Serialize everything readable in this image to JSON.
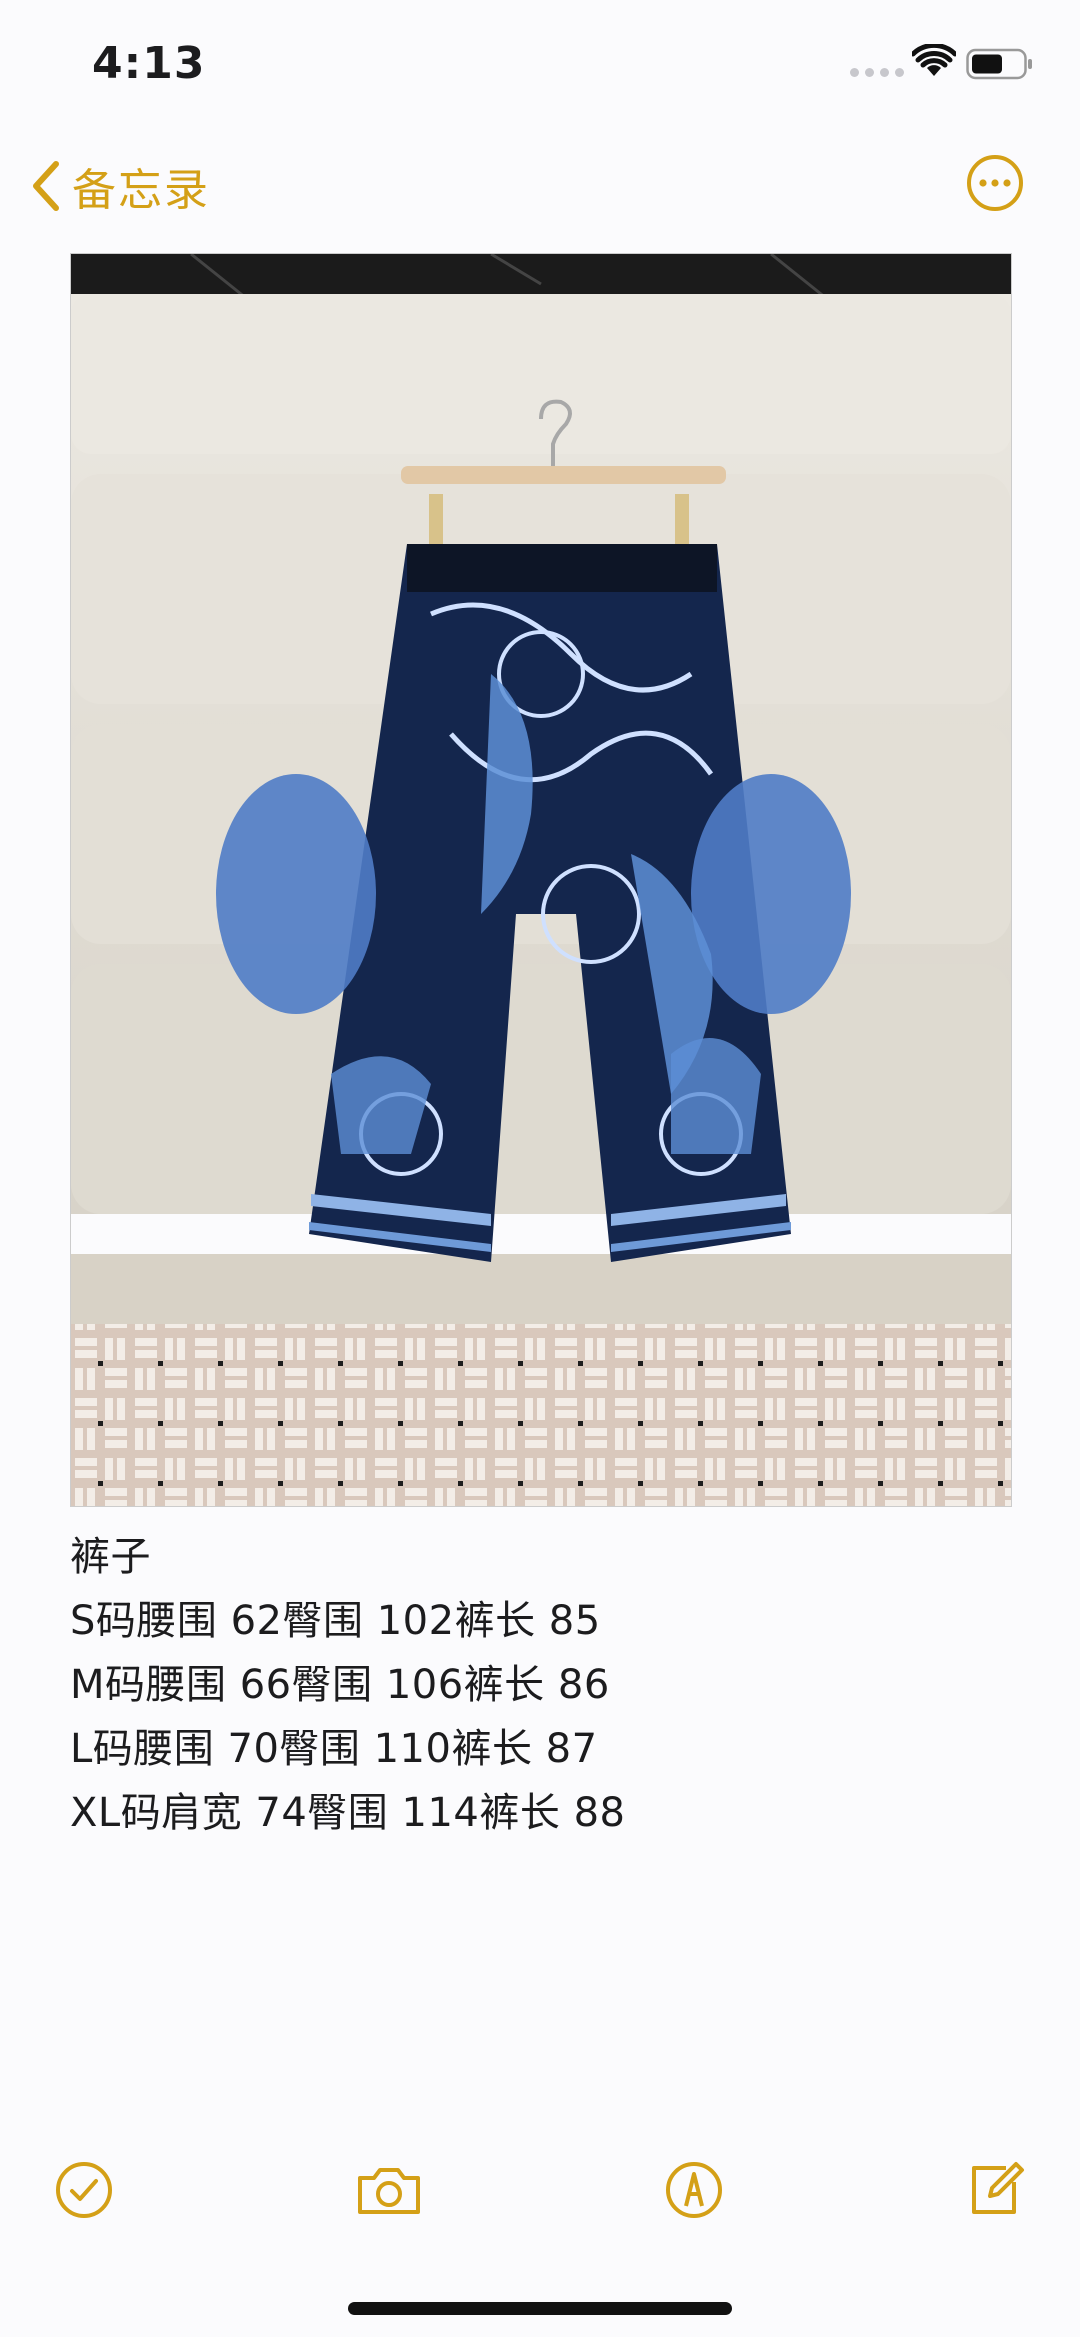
{
  "status_bar": {
    "time": "4:13"
  },
  "nav": {
    "back_label": "备忘录"
  },
  "note": {
    "lines": [
      "裤子",
      "S码腰围 62臀围 102裤长 85",
      "M码腰围 66臀围 106裤长 86",
      "L码腰围 70臀围 110裤长 87",
      "XL码肩宽 74臀围 114裤长 88"
    ]
  },
  "colors": {
    "accent": "#d4a017",
    "text": "#1c1c1e",
    "background": "#fbfbfd"
  },
  "icons": {
    "toolbar": [
      "checklist-icon",
      "camera-icon",
      "markup-pen-icon",
      "compose-icon"
    ],
    "nav": [
      "chevron-left-icon",
      "more-ellipsis-icon"
    ]
  }
}
